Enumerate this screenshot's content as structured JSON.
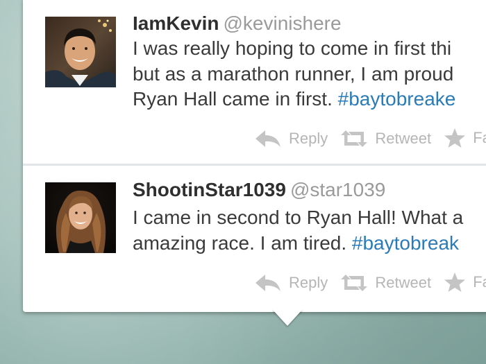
{
  "tweets": [
    {
      "name": "IamKevin",
      "handle": "@kevinishere",
      "lines": [
        "I was really hoping to come in first thi",
        "but as a marathon runner, I am proud",
        "Ryan Hall came in first."
      ],
      "hashtag": "#baytobreake",
      "actions": {
        "reply": "Reply",
        "retweet": "Retweet",
        "favorite": "Fa"
      }
    },
    {
      "name": "ShootinStar1039",
      "handle": "@star1039",
      "lines": [
        "I came in second to Ryan Hall! What a",
        "amazing race. I am tired."
      ],
      "hashtag": "#baytobreak",
      "actions": {
        "reply": "Reply",
        "retweet": "Retweet",
        "favorite": "Fa"
      }
    }
  ],
  "icons": {
    "reply": "reply-arrow-icon",
    "retweet": "retweet-icon",
    "favorite": "star-icon"
  },
  "colors": {
    "name": "#2f2f2f",
    "handle": "#9a9a9a",
    "hashtag": "#2b7bb9",
    "action": "#b5b5b5",
    "background": "#a9c4be"
  }
}
